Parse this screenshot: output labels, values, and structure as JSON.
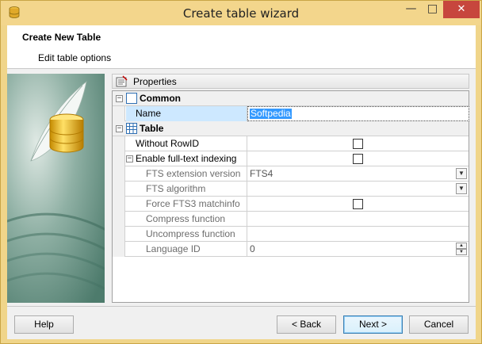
{
  "window": {
    "title": "Create table wizard",
    "minimize": "—",
    "maximize": "□",
    "close": "✕"
  },
  "header": {
    "title": "Create New Table",
    "subtitle": "Edit table options"
  },
  "properties": {
    "panel_label": "Properties",
    "categories": [
      {
        "label": "Common",
        "expander": "−"
      },
      {
        "label": "Table",
        "expander": "−"
      }
    ],
    "rows": {
      "name": {
        "label": "Name",
        "value": "Softpedia"
      },
      "without_rowid": {
        "label": "Without RowID",
        "checked": false
      },
      "enable_fts": {
        "label": "Enable full-text indexing",
        "checked": false,
        "expander": "−"
      },
      "fts_version": {
        "label": "FTS extension version",
        "value": "FTS4"
      },
      "fts_algorithm": {
        "label": "FTS algorithm",
        "value": ""
      },
      "force_fts3": {
        "label": "Force FTS3 matchinfo",
        "checked": false
      },
      "compress_fn": {
        "label": "Compress function",
        "value": ""
      },
      "uncompress_fn": {
        "label": "Uncompress function",
        "value": ""
      },
      "language_id": {
        "label": "Language ID",
        "value": "0"
      }
    }
  },
  "buttons": {
    "help": "Help",
    "back": "< Back",
    "next": "Next >",
    "cancel": "Cancel"
  },
  "icons": {
    "dropdown": "▼",
    "spin_up": "▲",
    "spin_down": "▼"
  },
  "colors": {
    "title_bar": "#f3d68c",
    "close_button": "#c7463d",
    "selection": "#3399ff",
    "side_pic": "#5e8a7c"
  }
}
